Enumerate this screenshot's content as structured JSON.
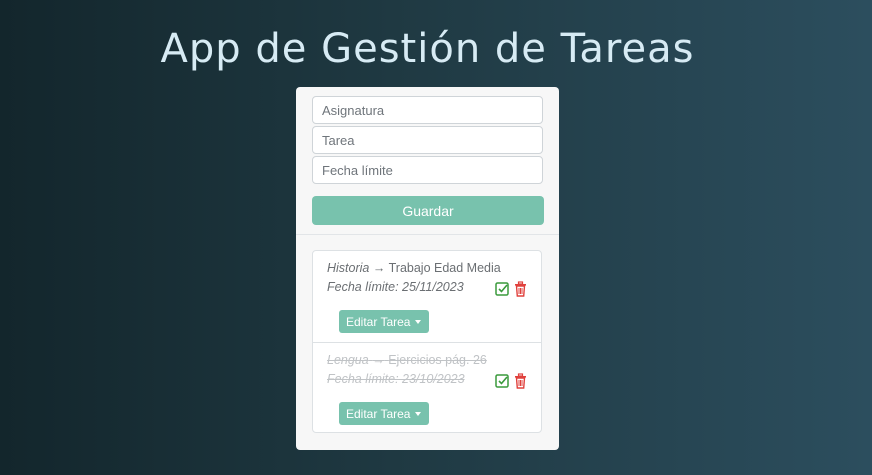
{
  "page": {
    "title": "App de Gestión de Tareas"
  },
  "form": {
    "subject": {
      "value": "",
      "placeholder": "Asignatura"
    },
    "task": {
      "value": "",
      "placeholder": "Tarea"
    },
    "deadline": {
      "value": "",
      "placeholder": "Fecha límite"
    },
    "save_label": "Guardar"
  },
  "tasks": [
    {
      "subject": "Historia",
      "arrow": "→",
      "task": "Trabajo Edad Media",
      "deadline": "Fecha límite: 25/11/2023",
      "completed": false,
      "edit_label": "Editar Tarea"
    },
    {
      "subject": "Lengua",
      "arrow": "→",
      "task": "Ejercicios pág. 26",
      "deadline": "Fecha límite: 23/10/2023",
      "completed": true,
      "edit_label": "Editar Tarea"
    }
  ],
  "icons": {
    "complete": "check-square-icon",
    "delete": "trash-icon"
  },
  "colors": {
    "accent": "#78c2ad",
    "check": "#3a9a3c",
    "delete": "#e0403c",
    "title": "#d7ebf4"
  }
}
